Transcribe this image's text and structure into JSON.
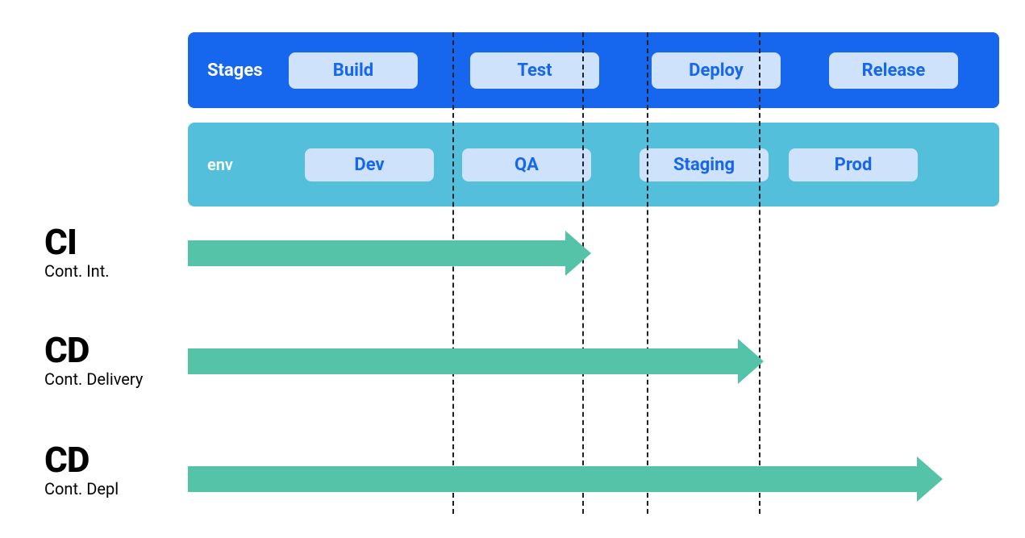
{
  "stages": {
    "label": "Stages",
    "items": [
      "Build",
      "Test",
      "Deploy",
      "Release"
    ]
  },
  "env": {
    "label": "env",
    "items": [
      "Dev",
      "QA",
      "Staging",
      "Prod"
    ]
  },
  "rows": [
    {
      "abbrev": "CI",
      "sub": "Cont. Int.",
      "reach": "Test"
    },
    {
      "abbrev": "CD",
      "sub": "Cont. Delivery",
      "reach": "Deploy"
    },
    {
      "abbrev": "CD",
      "sub": "Cont. Depl",
      "reach": "Release"
    }
  ]
}
